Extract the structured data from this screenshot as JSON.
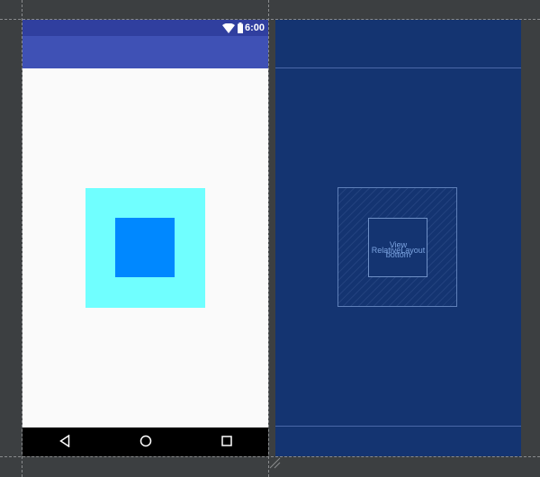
{
  "status_bar": {
    "time": "6:00",
    "color": "#303f9f"
  },
  "app_bar": {
    "color": "#3f51b5"
  },
  "layout": {
    "outer_color": "#70ffff",
    "inner_color": "#0088ff"
  },
  "navigation": {
    "back": "back-icon",
    "home": "home-icon",
    "recents": "recents-icon"
  },
  "blueprint": {
    "background": "#143471",
    "outer_label": "RelativeLayout",
    "inner_label_top": "View",
    "inner_label_bottom": "bottom"
  }
}
